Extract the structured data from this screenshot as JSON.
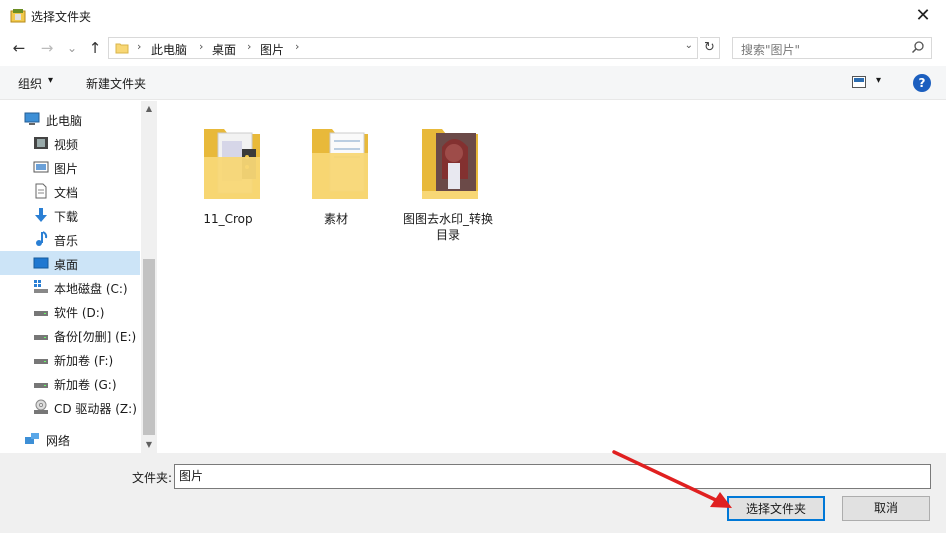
{
  "window": {
    "title": "选择文件夹",
    "close": "✕"
  },
  "nav": {
    "back": "←",
    "forward": "→",
    "recent": "⌄",
    "up": "↑"
  },
  "address": {
    "crumbs": [
      "此电脑",
      "桌面",
      "图片"
    ],
    "separator": "›",
    "dropdown": "⌄",
    "refresh": "↻"
  },
  "search": {
    "placeholder": "搜索\"图片\""
  },
  "toolbar": {
    "organize": "组织",
    "organize_caret": "▾",
    "new_folder": "新建文件夹",
    "view_caret": "▾",
    "help": "?"
  },
  "sidebar": {
    "items": [
      {
        "label": "此电脑",
        "icon": "computer-icon"
      },
      {
        "label": "视频",
        "icon": "video-icon"
      },
      {
        "label": "图片",
        "icon": "pictures-icon"
      },
      {
        "label": "文档",
        "icon": "documents-icon"
      },
      {
        "label": "下载",
        "icon": "download-icon"
      },
      {
        "label": "音乐",
        "icon": "music-icon"
      },
      {
        "label": "桌面",
        "icon": "desktop-icon",
        "selected": true
      },
      {
        "label": "本地磁盘 (C:)",
        "icon": "windows-drive-icon"
      },
      {
        "label": "软件 (D:)",
        "icon": "drive-icon"
      },
      {
        "label": "备份[勿删] (E:)",
        "icon": "drive-icon"
      },
      {
        "label": "新加卷 (F:)",
        "icon": "drive-icon"
      },
      {
        "label": "新加卷 (G:)",
        "icon": "drive-icon"
      },
      {
        "label": "CD 驱动器 (Z:)",
        "icon": "cd-drive-icon"
      },
      {
        "label": "网络",
        "icon": "network-icon"
      }
    ]
  },
  "content": {
    "folders": [
      {
        "name": "11_Crop",
        "name_line2": ""
      },
      {
        "name": "素材",
        "name_line2": ""
      },
      {
        "name": "图图去水印_转换",
        "name_line2": "目录"
      }
    ]
  },
  "footer": {
    "folder_label": "文件夹:",
    "folder_value": "图片",
    "select_button": "选择文件夹",
    "cancel_button": "取消"
  },
  "colors": {
    "accent": "#0078d7",
    "selection": "#cce4f7",
    "folder": "#f8d775",
    "arrow": "#e02020"
  }
}
